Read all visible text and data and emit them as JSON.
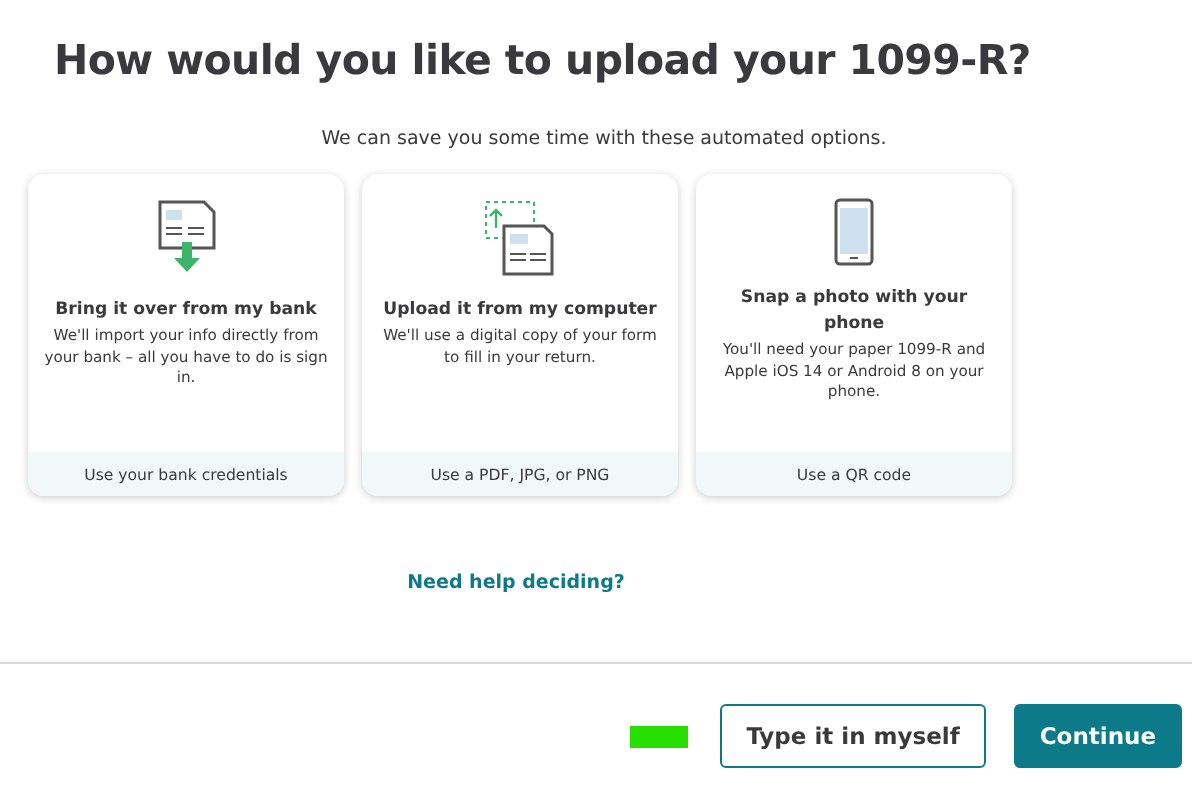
{
  "title": "How would you like to upload your 1099-R?",
  "subtitle": "We can save you some time with these automated options.",
  "options": [
    {
      "kind": "bank",
      "title": "Bring it over from my bank",
      "description": "We'll import your info directly from your bank – all you have to do is sign in.",
      "footer": "Use your bank credentials"
    },
    {
      "kind": "upload",
      "title": "Upload it from my computer",
      "description": "We'll use a digital copy of your form to fill in your return.",
      "footer": "Use a PDF, JPG, or PNG"
    },
    {
      "kind": "phone",
      "title": "Snap a photo with your phone",
      "description": "You'll need your paper 1099-R and Apple iOS 14 or Android 8 on your phone.",
      "footer": "Use a QR code"
    }
  ],
  "help_link": "Need help deciding?",
  "buttons": [
    {
      "kind": "secondary",
      "label": "Type it in myself"
    },
    {
      "kind": "primary",
      "label": "Continue"
    }
  ]
}
